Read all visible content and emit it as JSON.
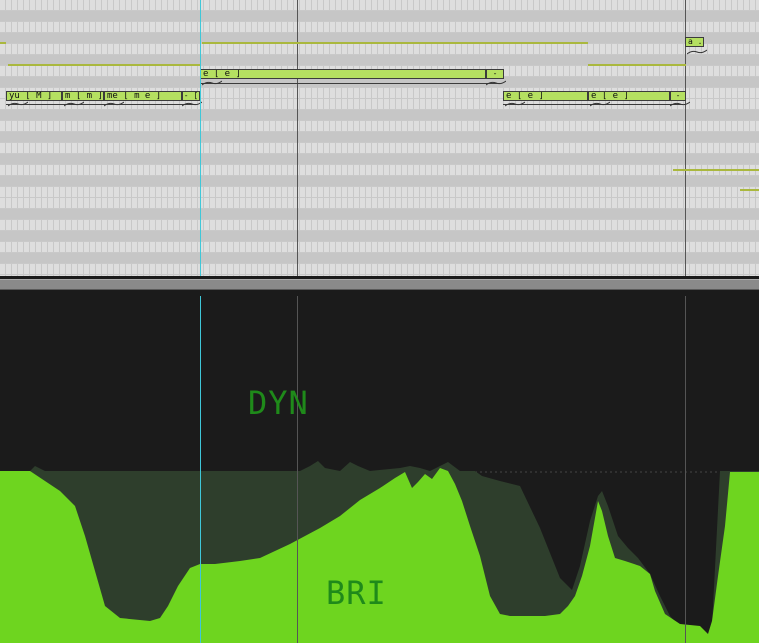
{
  "notes": [
    {
      "lyric": "yu [ M ]"
    },
    {
      "lyric": "m [ m ]"
    },
    {
      "lyric": "me [ m e ]"
    },
    {
      "lyric": "- ["
    },
    {
      "lyric": "e [ e ]"
    },
    {
      "lyric": "- [..."
    },
    {
      "lyric": "e [ e ]"
    },
    {
      "lyric": "e [ e ]"
    },
    {
      "lyric": "- [..."
    },
    {
      "lyric": "a ..."
    }
  ],
  "parameters": {
    "upper_label": "DYN",
    "lower_label": "BRI"
  },
  "colors": {
    "grid_background": "#dedede",
    "note_fill": "#b5e061",
    "pitch_line": "#aab83e",
    "playhead": "#3fc7d8",
    "parameter_fill": "#6ed51f",
    "parameter_shadow": "#2e3e2c",
    "label_green": "#1f8a1a"
  }
}
